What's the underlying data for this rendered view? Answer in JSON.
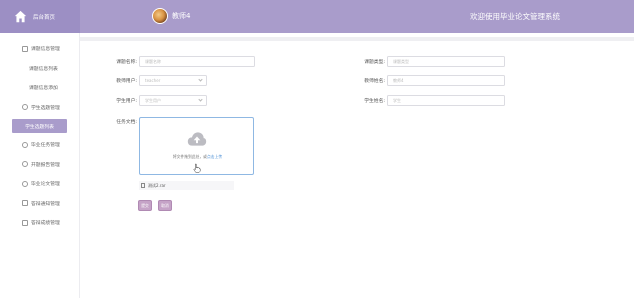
{
  "header": {
    "home_label": "后台首页",
    "username": "教师4",
    "welcome": "欢迎使用毕业论文管理系统"
  },
  "sidebar": {
    "items": [
      {
        "label": "课题信息管理",
        "type": "group"
      },
      {
        "label": "课题信息列表",
        "type": "sub"
      },
      {
        "label": "课题信息添加",
        "type": "sub"
      },
      {
        "label": "学生选题管理",
        "type": "group"
      },
      {
        "label": "学生选题列表",
        "type": "active"
      },
      {
        "label": "毕业任务管理",
        "type": "group"
      },
      {
        "label": "开题报告管理",
        "type": "group"
      },
      {
        "label": "毕业论文管理",
        "type": "group"
      },
      {
        "label": "答辩通知管理",
        "type": "group"
      },
      {
        "label": "答辩成绩管理",
        "type": "group"
      }
    ]
  },
  "form": {
    "topic_name_label": "课题名称:",
    "topic_name_placeholder": "课题名称",
    "topic_type_label": "课题类型:",
    "topic_type_placeholder": "课题类型",
    "teacher_user_label": "教师用户:",
    "teacher_user_value": "teacher",
    "teacher_name_label": "教师姓名:",
    "teacher_name_value": "教师4",
    "student_user_label": "学生用户:",
    "student_user_value": "学生用户",
    "student_name_label": "学生姓名:",
    "student_name_value": "学生",
    "task_doc_label": "任务文档:",
    "upload_text": "将文件拖到此处，或",
    "upload_link": "点击上传",
    "file_name": "测试2.rar",
    "submit_label": "提交",
    "cancel_label": "取消"
  }
}
